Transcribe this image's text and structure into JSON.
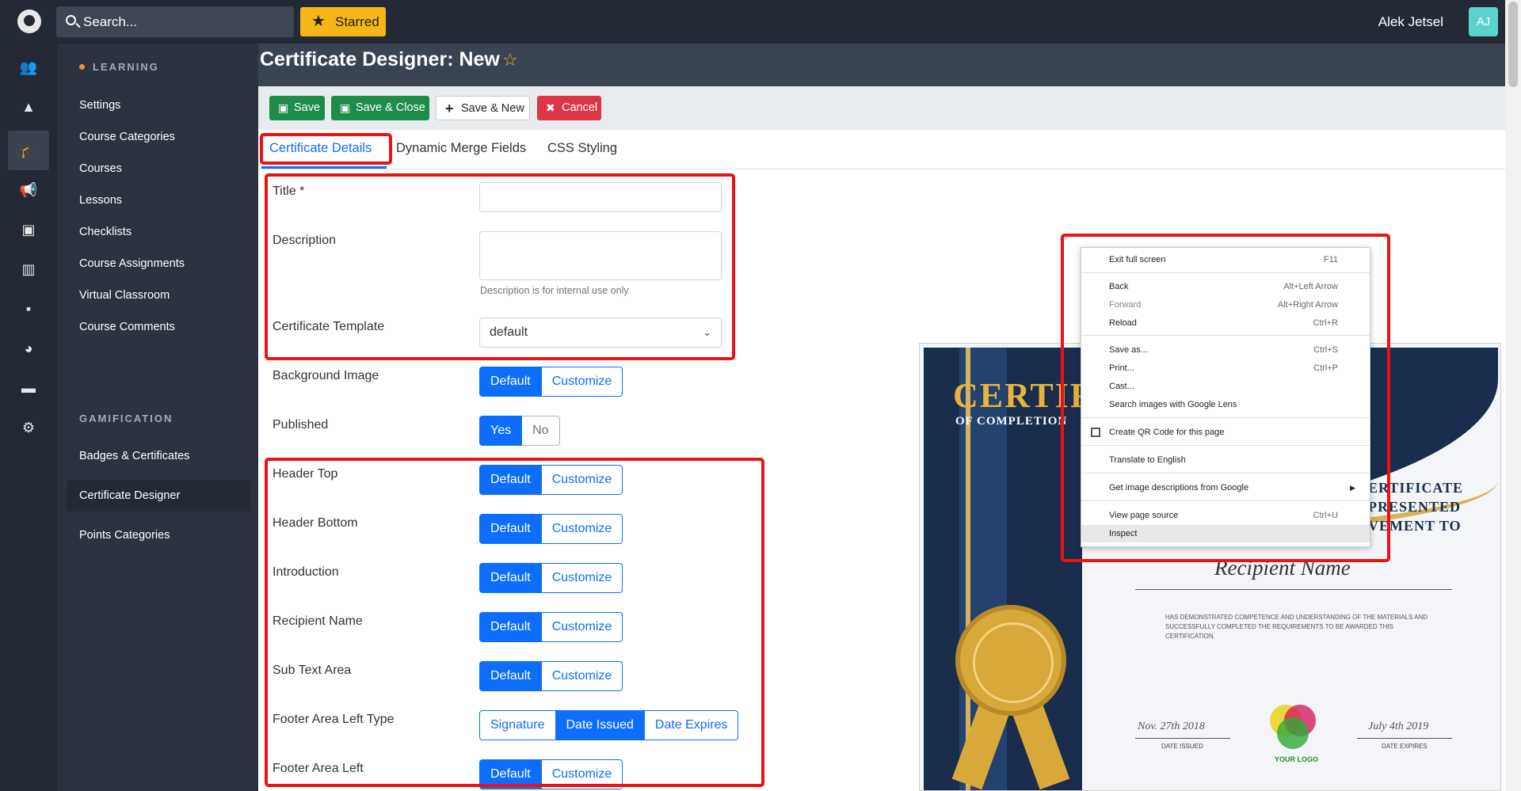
{
  "topbar": {
    "search_placeholder": "Search...",
    "starred_label": "Starred",
    "user_name": "Alek Jetsel",
    "avatar_initials": "AJ"
  },
  "rail": {
    "icons": [
      "users-icon",
      "shapes-icon",
      "graduation-cap-icon",
      "megaphone-icon",
      "money-icon",
      "chart-icon",
      "comment-icon",
      "palette-icon",
      "window-icon",
      "gear-icon"
    ]
  },
  "sidebar": {
    "section_learning": "LEARNING",
    "learning_items": [
      "Settings",
      "Course Categories",
      "Courses",
      "Lessons",
      "Checklists",
      "Course Assignments",
      "Virtual Classroom",
      "Course Comments"
    ],
    "section_gamification": "GAMIFICATION",
    "gamification_items": [
      "Badges & Certificates",
      "Certificate Designer",
      "Points Categories"
    ],
    "active_item": "Certificate Designer"
  },
  "page": {
    "title": "Certificate Designer: New"
  },
  "toolbar": {
    "save": "Save",
    "save_close": "Save & Close",
    "save_new": "Save & New",
    "cancel": "Cancel"
  },
  "tabs": {
    "details": "Certificate Details",
    "merge_fields": "Dynamic Merge Fields",
    "css": "CSS Styling",
    "active": "Certificate Details"
  },
  "form": {
    "title_label": "Title *",
    "title_value": "",
    "description_label": "Description",
    "description_value": "",
    "description_help": "Description is for internal use only",
    "template_label": "Certificate Template",
    "template_value": "default",
    "background_label": "Background Image",
    "published_label": "Published",
    "published_yes": "Yes",
    "published_no": "No",
    "header_top_label": "Header Top",
    "header_bottom_label": "Header Bottom",
    "introduction_label": "Introduction",
    "recipient_label": "Recipient Name",
    "subtext_label": "Sub Text Area",
    "footer_left_type_label": "Footer Area Left Type",
    "footer_left_label": "Footer Area Left",
    "opt_default": "Default",
    "opt_customize": "Customize",
    "opt_signature": "Signature",
    "opt_date_issued": "Date Issued",
    "opt_date_expires": "Date Expires"
  },
  "certificate": {
    "title": "CERTIF",
    "subtitle": "OF COMPLETION",
    "right_line1": "ERTIFICATE",
    "right_line2": "PRESENTED",
    "right_line3": "VEMENT TO",
    "recipient": "Recipient Name",
    "body_text": "HAS DEMONSTRATED COMPETENCE AND UNDERSTANDING OF THE MATERIALS AND SUCCESSFULLY COMPLETED THE REQUIREMENTS TO BE AWARDED THIS CERTIFICATION.",
    "date_issued_value": "Nov. 27th 2018",
    "date_issued_label": "DATE ISSUED",
    "date_expires_value": "July 4th 2019",
    "date_expires_label": "DATE EXPIRES",
    "logo_text": "YOUR LOGO"
  },
  "context_menu": {
    "items": [
      {
        "label": "Exit full screen",
        "shortcut": "F11"
      },
      {
        "label": "Back",
        "shortcut": "Alt+Left Arrow"
      },
      {
        "label": "Forward",
        "shortcut": "Alt+Right Arrow"
      },
      {
        "label": "Reload",
        "shortcut": "Ctrl+R"
      },
      {
        "label": "Save as...",
        "shortcut": "Ctrl+S"
      },
      {
        "label": "Print...",
        "shortcut": "Ctrl+P"
      },
      {
        "label": "Cast...",
        "shortcut": ""
      },
      {
        "label": "Search images with Google Lens",
        "shortcut": ""
      },
      {
        "label": "Create QR Code for this page",
        "shortcut": ""
      },
      {
        "label": "Translate to English",
        "shortcut": ""
      },
      {
        "label": "Get image descriptions from Google",
        "shortcut": ""
      },
      {
        "label": "View page source",
        "shortcut": "Ctrl+U"
      },
      {
        "label": "Inspect",
        "shortcut": ""
      }
    ]
  },
  "colors": {
    "primary": "#0d6efd",
    "success": "#1e8c4a",
    "danger": "#dc3545",
    "warning": "#f5b717",
    "highlight": "#ee1111",
    "sidebar": "#2c3340"
  }
}
